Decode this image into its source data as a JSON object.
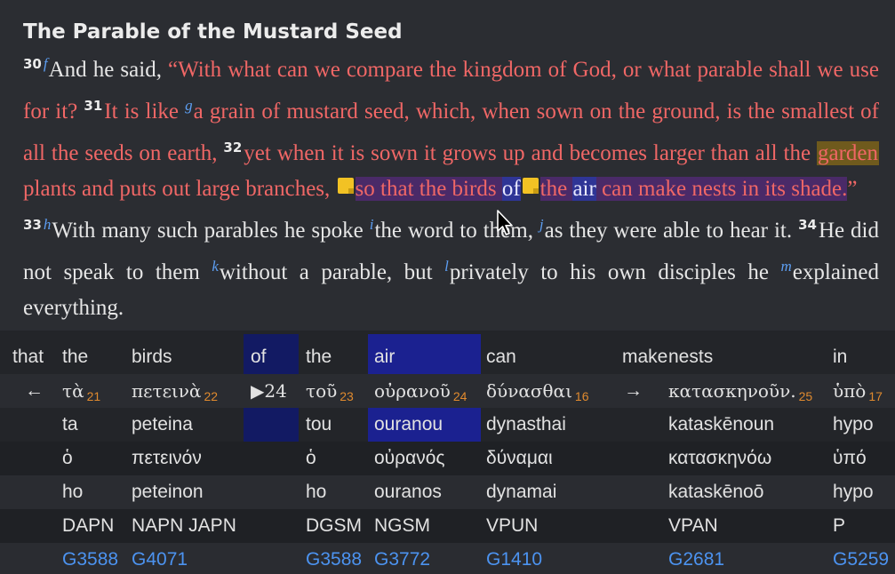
{
  "reader": {
    "heading": "The Parable of the Mustard Seed",
    "v30_num": "30",
    "v30_fn": "f",
    "v30_intro": "And he said, ",
    "v30_quote": "“With what can we compare the kingdom of God, or what parable shall we use for it?",
    "v31_num": "31",
    "v31_a": "It is like ",
    "v31_fn": "g",
    "v31_b": "a grain of mustard seed, which, when sown on the ground, is the smallest of all the seeds on earth,",
    "v32_num": "32",
    "v32_a": "yet when it is sown it grows up and becomes larger than all the ",
    "v32_garden": "garden",
    "v32_b": " plants and puts out large branches,",
    "v32_c": "so that the birds ",
    "v32_of": "of",
    "v32_the": "the ",
    "v32_air": "air",
    "v32_d": " can make nests in its shade.",
    "v32_end": "”",
    "v33_num": "33",
    "v33_fn_h": "h",
    "v33_a": "With many such parables he spoke ",
    "v33_fn_i": "i",
    "v33_b": "the word to them, ",
    "v33_fn_j": "j",
    "v33_c": "as they were able to hear it.",
    "v34_num": "34",
    "v34_a": "He did not speak to them ",
    "v34_fn_k": "k",
    "v34_b": "without a parable, but ",
    "v34_fn_l": "l",
    "v34_c": "privately to his own disciples he ",
    "v34_fn_m": "m",
    "v34_d": "explained everything."
  },
  "interlinear": {
    "english": [
      "that",
      "the",
      "birds",
      "of",
      "the",
      "air",
      "can",
      "make",
      "nests",
      "in"
    ],
    "greek": [
      {
        "arrow": "←"
      },
      {
        "word": "τὰ",
        "num": "21"
      },
      {
        "word": "πετεινὰ",
        "num": "22"
      },
      {
        "word": "▶24"
      },
      {
        "word": "τοῦ",
        "num": "23"
      },
      {
        "word": "οὐρανοῦ",
        "num": "24"
      },
      {
        "word": "δύνασθαι",
        "num": "16"
      },
      {
        "arrow": "→"
      },
      {
        "word": "κατασκηνοῦν.",
        "num": "25"
      },
      {
        "word": "ὑπὸ",
        "num": "17"
      }
    ],
    "translit": [
      "",
      "ta",
      "peteina",
      "",
      "tou",
      "ouranou",
      "dynasthai",
      "",
      "kataskēnoun",
      "hypo"
    ],
    "lemma": [
      "",
      "ὁ",
      "πετεινόν",
      "",
      "ὁ",
      "οὐρανός",
      "δύναμαι",
      "",
      "κατασκηνόω",
      "ὑπό"
    ],
    "lemma_translit": [
      "",
      "ho",
      "peteinon",
      "",
      "ho",
      "ouranos",
      "dynamai",
      "",
      "kataskēnoō",
      "hypo"
    ],
    "morph": [
      "",
      "DAPN",
      "NAPN JAPN",
      "",
      "DGSM",
      "NGSM",
      "VPUN",
      "",
      "VPAN",
      "P"
    ],
    "strongs": [
      "",
      "G3588",
      "G4071",
      "",
      "G3588",
      "G3772",
      "G1410",
      "",
      "G2681",
      "G5259"
    ]
  },
  "colors": {
    "verse_text": "#f06766",
    "footnote": "#5d9ef2",
    "strongs": "#4c93f0",
    "word_number": "#e08a2e",
    "highlight_orange": "#6f5a1d",
    "highlight_purple": "#4a2a68",
    "highlight_blue": "#2f3596"
  }
}
